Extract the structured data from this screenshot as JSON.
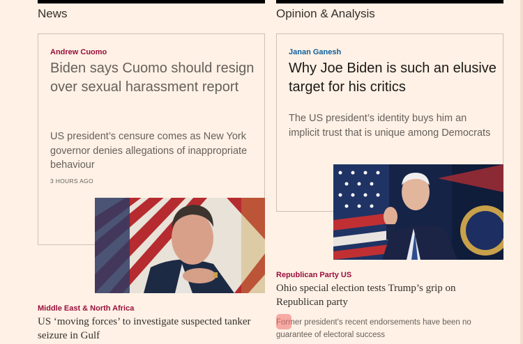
{
  "news": {
    "section_title": "News",
    "lead": {
      "tag": "Andrew Cuomo",
      "headline": "Biden says Cuomo should resign over sexual harassment report",
      "standfirst": "US president’s censure comes as New York governor denies allegations of inappropriate behaviour",
      "timestamp": "3 HOURS AGO"
    },
    "second": {
      "tag": "Middle East & North Africa",
      "headline": "US ‘moving forces’ to investigate suspected tanker seizure in Gulf"
    }
  },
  "opinion": {
    "section_title": "Opinion & Analysis",
    "lead": {
      "tag": "Janan Ganesh",
      "headline": "Why Joe Biden is such an elusive target for his critics",
      "standfirst": "The US president’s identity buys him an implicit trust that is unique among Democrats"
    },
    "second": {
      "tag": "Republican Party US",
      "headline": "Ohio special election tests Trump’s grip on Republican party",
      "standfirst": "Former president’s recent endorsements have been no guarantee of electoral success"
    }
  },
  "colors": {
    "background": "#fff1e5",
    "news_tag": "#990f3d",
    "opinion_tag": "#0d7680",
    "border": "#ccc1b7"
  }
}
